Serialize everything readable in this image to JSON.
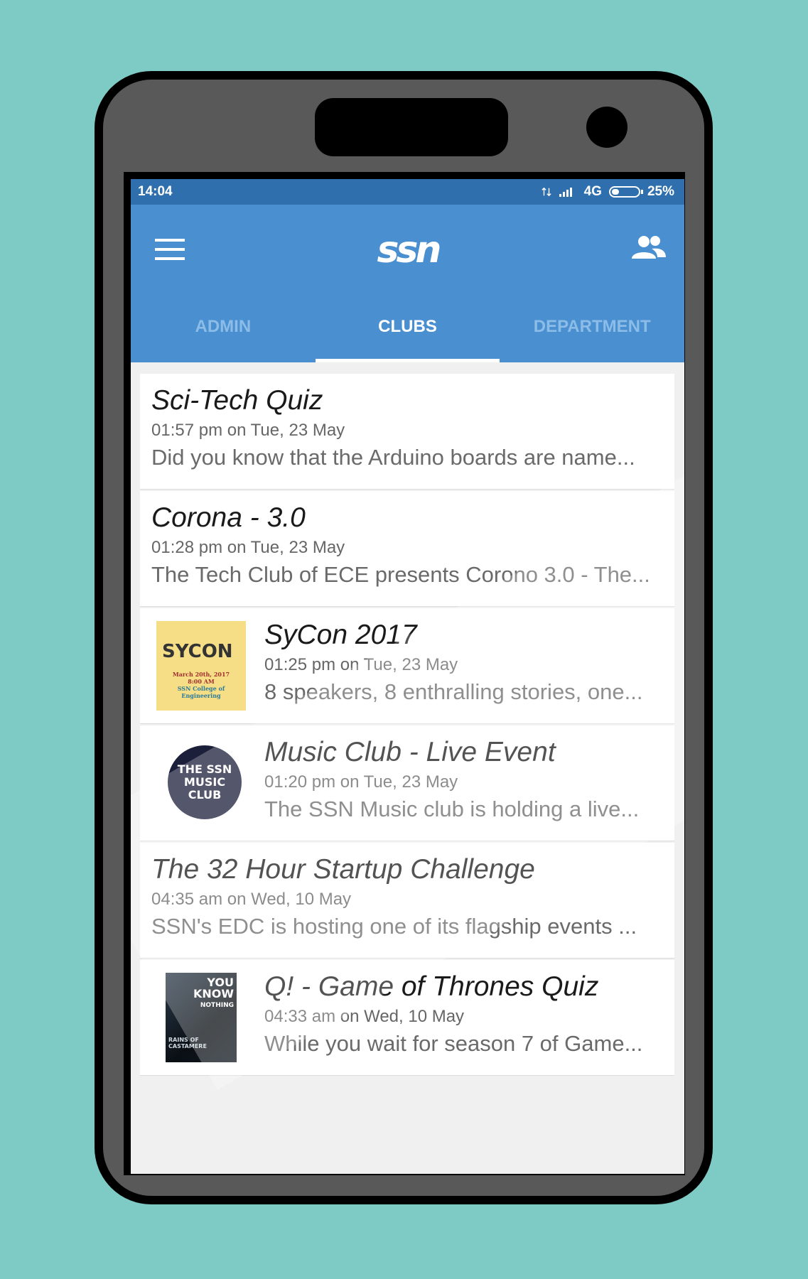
{
  "status_bar": {
    "time": "14:04",
    "network": "4G",
    "battery": "25%"
  },
  "app_bar": {
    "logo_text": "ssn",
    "menu_icon": "hamburger-menu-icon",
    "people_icon": "people-icon"
  },
  "tabs": [
    {
      "label": "ADMIN",
      "active": false
    },
    {
      "label": "CLUBS",
      "active": true
    },
    {
      "label": "DEPARTMENT",
      "active": false
    }
  ],
  "posts": [
    {
      "title": "Sci-Tech Quiz",
      "time": "01:57 pm on Tue, 23 May",
      "desc": "Did you know that the Arduino boards are name..."
    },
    {
      "title": "Corona - 3.0",
      "time": "01:28 pm on Tue, 23 May",
      "desc": "The Tech Club of ECE presents Corono 3.0 - The..."
    },
    {
      "title": "SyCon 2017",
      "time": "01:25 pm on Tue, 23 May",
      "desc": "8 speakers, 8 enthralling stories, one...",
      "thumb": {
        "logo": "SYCON",
        "date": "March 20th, 2017",
        "time": "8:00 AM",
        "venue": "SSN College of Engineering"
      }
    },
    {
      "title": "Music Club - Live Event",
      "time": "01:20 pm on Tue, 23 May",
      "desc": "The SSN Music club is holding a live...",
      "thumb": {
        "line1": "THE SSN",
        "line2": "MUSIC CLUB"
      }
    },
    {
      "title": "The 32 Hour Startup Challenge",
      "time": "04:35 am on Wed, 10 May",
      "desc": "SSN's EDC is hosting one of its flagship events ..."
    },
    {
      "title": "Q! - Game of Thrones Quiz",
      "time": "04:33 am on Wed, 10 May",
      "desc": "While you wait for season 7 of Game...",
      "thumb": {
        "line1": "YOU",
        "line2": "KNOW",
        "line3": "NOTHING",
        "caption": "RAINS OF CASTAMERE"
      }
    }
  ],
  "colors": {
    "background": "#7ecbc6",
    "status_bar": "#2f6fad",
    "app_bar": "#4a8fd0",
    "tab_inactive": "#8cbde8",
    "tab_active": "#ffffff"
  }
}
